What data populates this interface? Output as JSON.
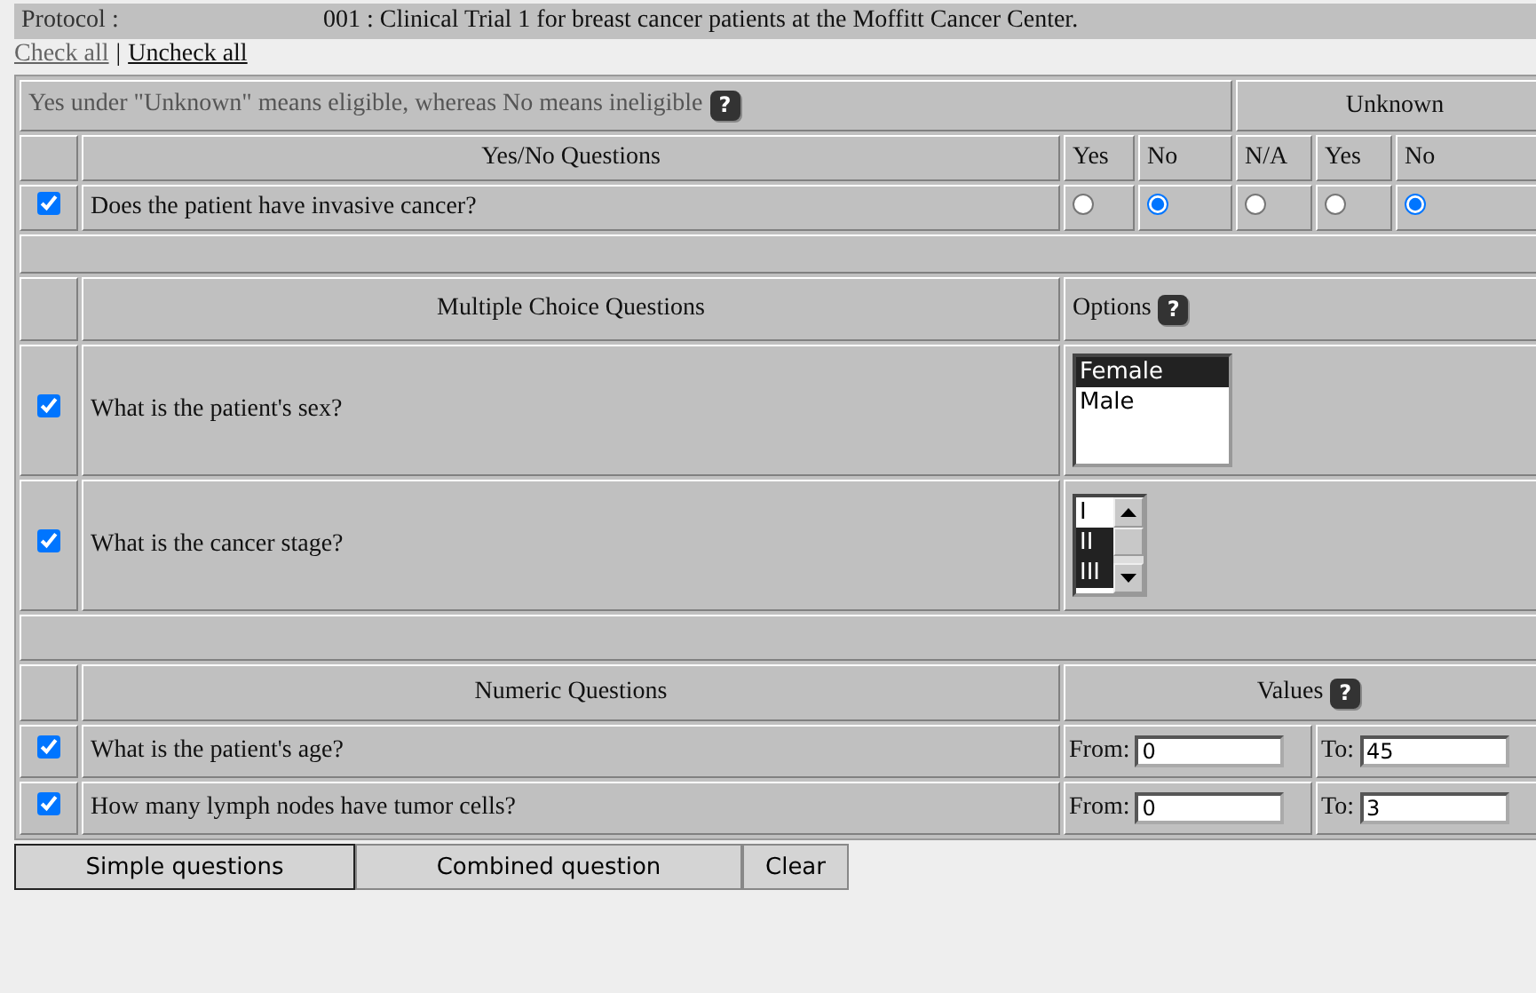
{
  "protocol": {
    "label": "Protocol :",
    "value": "001 : Clinical Trial 1 for breast cancer patients at the Moffitt Cancer Center."
  },
  "links": {
    "check_all": "Check all",
    "separator": "|",
    "uncheck_all": "Uncheck all"
  },
  "legend": {
    "text": "Yes under \"Unknown\" means eligible, whereas No means ineligible",
    "help": "?",
    "unknown_header": "Unknown"
  },
  "yes_no": {
    "heading": "Yes/No Questions",
    "columns": [
      "Yes",
      "No",
      "N/A",
      "Yes",
      "No"
    ],
    "questions": [
      {
        "checked": true,
        "text": "Does the patient have invasive cancer?",
        "answers": [
          {
            "selected": false
          },
          {
            "selected": true
          },
          {
            "selected": false
          },
          {
            "selected": false
          },
          {
            "selected": true
          }
        ]
      }
    ]
  },
  "multiple_choice": {
    "heading": "Multiple Choice Questions",
    "options_header": "Options",
    "help": "?",
    "questions": [
      {
        "checked": true,
        "text": "What is the patient's sex?",
        "kind": "list",
        "options": [
          {
            "label": "Female",
            "selected": true
          },
          {
            "label": "Male",
            "selected": false
          }
        ]
      },
      {
        "checked": true,
        "text": "What is the cancer stage?",
        "kind": "scroll_list",
        "options": [
          {
            "label": "I",
            "selected": false
          },
          {
            "label": "II",
            "selected": true
          },
          {
            "label": "III",
            "selected": true
          }
        ]
      }
    ]
  },
  "numeric": {
    "heading": "Numeric Questions",
    "values_header": "Values",
    "help": "?",
    "questions": [
      {
        "checked": true,
        "text": "What is the patient's age?",
        "from_label": "From:",
        "from": "0",
        "to_label": "To:",
        "to": "45"
      },
      {
        "checked": true,
        "text": "How many lymph nodes have tumor cells?",
        "from_label": "From:",
        "from": "0",
        "to_label": "To:",
        "to": "3"
      }
    ]
  },
  "buttons": [
    {
      "label": "Simple questions",
      "focused": true
    },
    {
      "label": "Combined question",
      "focused": false
    },
    {
      "label": "Clear",
      "focused": false
    }
  ]
}
